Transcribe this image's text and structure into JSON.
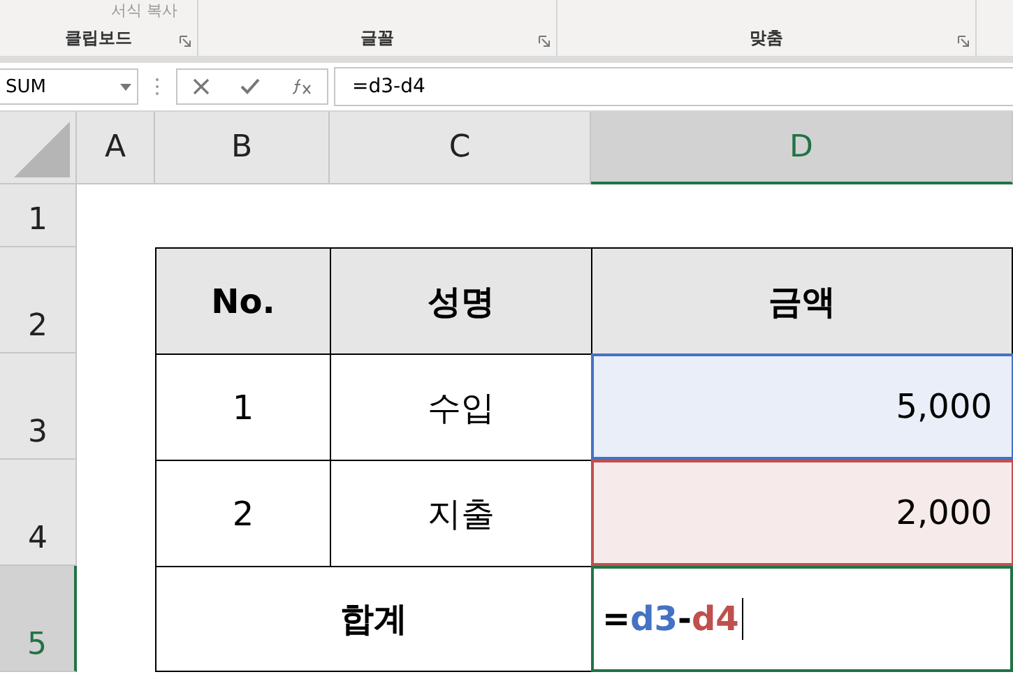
{
  "ribbon": {
    "groups": [
      {
        "label": "클립보드",
        "top_text": "서식 복사"
      },
      {
        "label": "글꼴"
      },
      {
        "label": "맞춤"
      }
    ]
  },
  "formula_bar": {
    "name_box": "SUM",
    "formula": "=d3-d4"
  },
  "columns": [
    {
      "label": "A",
      "selected": false
    },
    {
      "label": "B",
      "selected": false
    },
    {
      "label": "C",
      "selected": false
    },
    {
      "label": "D",
      "selected": true
    }
  ],
  "rows": [
    {
      "label": "1",
      "selected": false
    },
    {
      "label": "2",
      "selected": false
    },
    {
      "label": "3",
      "selected": false
    },
    {
      "label": "4",
      "selected": false
    },
    {
      "label": "5",
      "selected": true
    }
  ],
  "table": {
    "headers": [
      "No.",
      "성명",
      "금액"
    ],
    "rows": [
      {
        "no": "1",
        "name": "수입",
        "amount": "5,000",
        "color": "#4472c4"
      },
      {
        "no": "2",
        "name": "지출",
        "amount": "2,000",
        "color": "#c0504d"
      }
    ],
    "total_label": "합계",
    "editing_formula": [
      {
        "kind": "text",
        "text": "="
      },
      {
        "kind": "ref",
        "text": "d3",
        "color": "#4472c4"
      },
      {
        "kind": "text",
        "text": "-"
      },
      {
        "kind": "ref",
        "text": "d4",
        "color": "#c0504d"
      }
    ]
  }
}
